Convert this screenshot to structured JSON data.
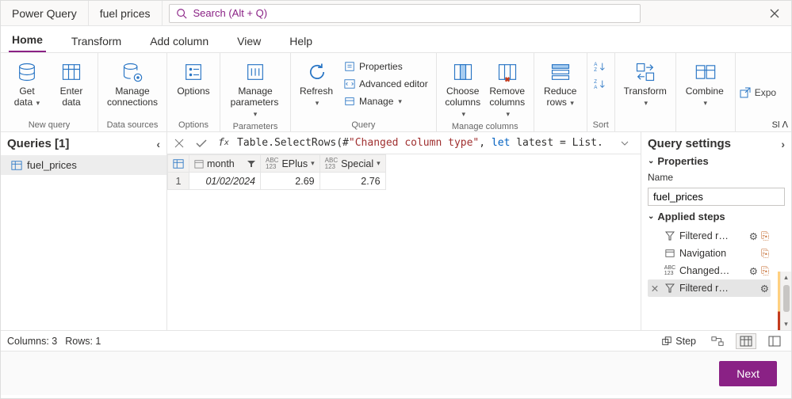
{
  "title": {
    "app": "Power Query",
    "doc": "fuel prices"
  },
  "search": {
    "placeholder": "Search (Alt + Q)"
  },
  "menu": {
    "tabs": [
      "Home",
      "Transform",
      "Add column",
      "View",
      "Help"
    ],
    "active": 0
  },
  "ribbon": {
    "new_query": {
      "get_data": "Get data",
      "enter_data": "Enter data",
      "label": "New query"
    },
    "data_sources": {
      "manage_conn": "Manage connections",
      "label": "Data sources"
    },
    "options": {
      "options": "Options",
      "label": "Options"
    },
    "parameters": {
      "manage_params": "Manage parameters",
      "label": "Parameters"
    },
    "query": {
      "refresh": "Refresh",
      "properties": "Properties",
      "adv_editor": "Advanced editor",
      "manage": "Manage",
      "label": "Query"
    },
    "manage_cols": {
      "choose": "Choose columns",
      "remove": "Remove columns",
      "label": "Manage columns"
    },
    "reduce": {
      "reduce_rows": "Reduce rows",
      "label": ""
    },
    "sort": {
      "label": "Sort"
    },
    "transform": {
      "transform": "Transform",
      "label": ""
    },
    "combine": {
      "combine": "Combine",
      "label": ""
    },
    "expo": "Expo",
    "collapse_hint": "Sl"
  },
  "queries": {
    "header": "Queries [1]",
    "items": [
      {
        "name": "fuel_prices"
      }
    ]
  },
  "formula": {
    "prefix": "Table.SelectRows(#",
    "str": "\"Changed column type\"",
    "mid": ", ",
    "kw": "let",
    "rest": " latest = List."
  },
  "grid": {
    "columns": [
      {
        "name": "month",
        "type": "date",
        "filter": true
      },
      {
        "name": "EPlus",
        "type": "abc123"
      },
      {
        "name": "Special",
        "type": "abc123"
      }
    ],
    "rows": [
      {
        "n": "1",
        "cells": [
          "01/02/2024",
          "2.69",
          "2.76"
        ]
      }
    ]
  },
  "settings": {
    "header": "Query settings",
    "properties": "Properties",
    "name_label": "Name",
    "name_value": "fuel_prices",
    "applied_steps": "Applied steps",
    "steps": [
      {
        "icon": "filter",
        "label": "Filtered r…",
        "gear": true,
        "warn": true
      },
      {
        "icon": "table",
        "label": "Navigation",
        "gear": false,
        "warn": true
      },
      {
        "icon": "abc123",
        "label": "Changed…",
        "gear": true,
        "warn": true
      },
      {
        "icon": "filter",
        "label": "Filtered r…",
        "gear": true,
        "warn": false,
        "selected": true
      }
    ]
  },
  "status": {
    "cols": "Columns: 3",
    "rows": "Rows: 1",
    "step": "Step"
  },
  "footer": {
    "next": "Next"
  }
}
